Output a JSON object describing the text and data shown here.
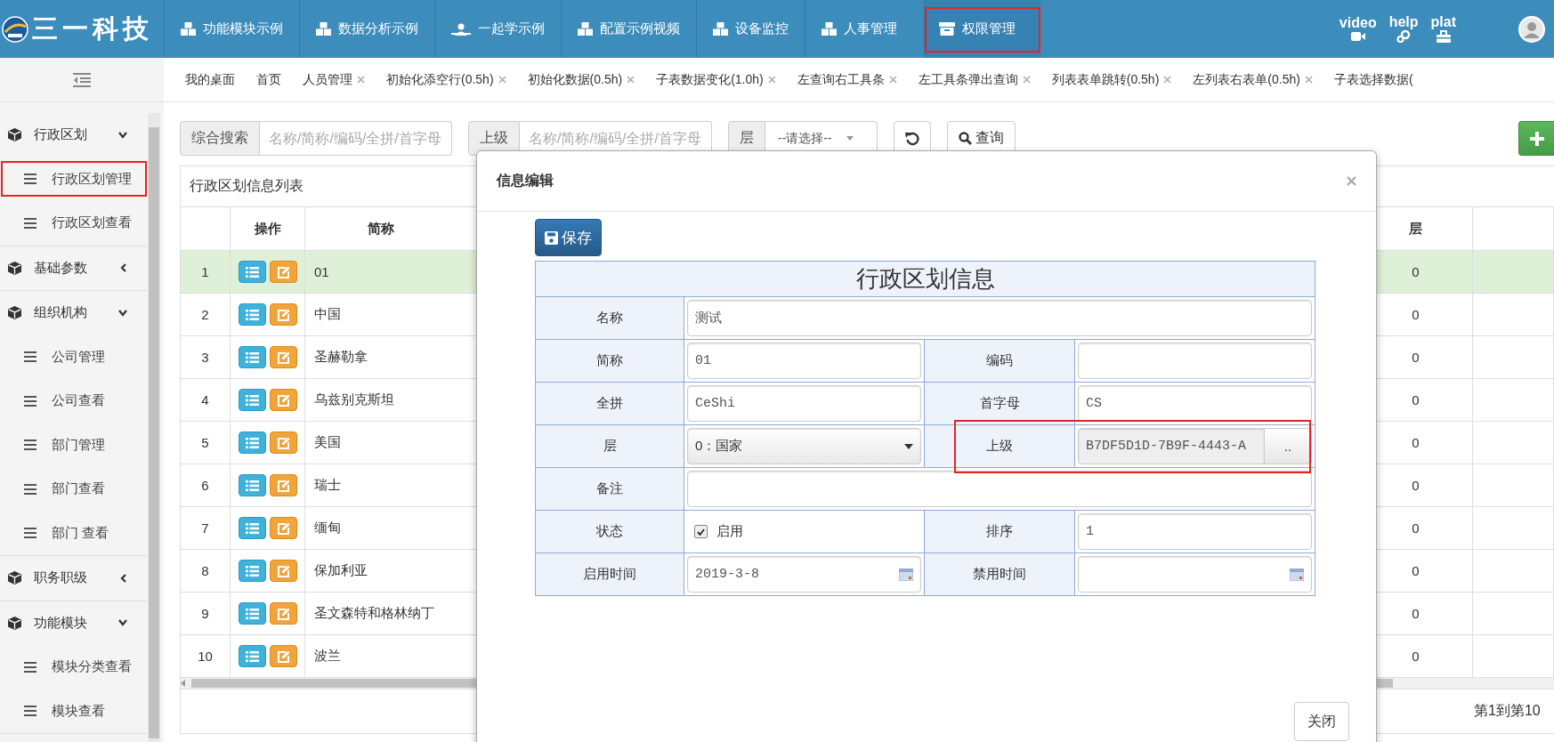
{
  "header": {
    "logo_text": "三一科技",
    "nav": [
      {
        "label": "功能模块示例",
        "kind": "boxes",
        "selected": false,
        "highlighted": false
      },
      {
        "label": "数据分析示例",
        "kind": "boxes",
        "selected": false,
        "highlighted": false
      },
      {
        "label": "一起学示例",
        "kind": "person",
        "selected": false,
        "highlighted": false
      },
      {
        "label": "配置示例视频",
        "kind": "boxes",
        "selected": false,
        "highlighted": false
      },
      {
        "label": "设备监控",
        "kind": "boxes",
        "selected": false,
        "highlighted": false
      },
      {
        "label": "人事管理",
        "kind": "boxes",
        "selected": false,
        "highlighted": false
      },
      {
        "label": "权限管理",
        "kind": "box",
        "selected": true,
        "highlighted": true
      }
    ],
    "shortcuts": [
      {
        "label": "video",
        "kind": "camera"
      },
      {
        "label": "help",
        "kind": "gears"
      },
      {
        "label": "plat",
        "kind": "toolbox"
      }
    ]
  },
  "tabs": [
    {
      "label": "我的桌面",
      "closable": false
    },
    {
      "label": "首页",
      "closable": false
    },
    {
      "label": "人员管理",
      "closable": true
    },
    {
      "label": "初始化添空行(0.5h)",
      "closable": true
    },
    {
      "label": "初始化数据(0.5h)",
      "closable": true
    },
    {
      "label": "子表数据变化(1.0h)",
      "closable": true
    },
    {
      "label": "左查询右工具条",
      "closable": true
    },
    {
      "label": "左工具条弹出查询",
      "closable": true
    },
    {
      "label": "列表表单跳转(0.5h)",
      "closable": true
    },
    {
      "label": "左列表右表单(0.5h)",
      "closable": true
    },
    {
      "label": "子表选择数据(",
      "closable": false
    }
  ],
  "sidebar": {
    "groups": [
      {
        "label": "行政区划",
        "expanded": true,
        "children": [
          {
            "label": "行政区划管理",
            "highlighted": true
          },
          {
            "label": "行政区划查看",
            "highlighted": false
          }
        ]
      },
      {
        "label": "基础参数",
        "expanded": false
      },
      {
        "label": "组织机构",
        "expanded": true,
        "children": [
          {
            "label": "公司管理",
            "highlighted": false
          },
          {
            "label": "公司查看",
            "highlighted": false
          },
          {
            "label": "部门管理",
            "highlighted": false
          },
          {
            "label": "部门查看",
            "highlighted": false
          },
          {
            "label": "部门 查看",
            "highlighted": false
          }
        ]
      },
      {
        "label": "职务职级",
        "expanded": false
      },
      {
        "label": "功能模块",
        "expanded": true,
        "children": [
          {
            "label": "模块分类查看",
            "highlighted": false
          },
          {
            "label": "模块查看",
            "highlighted": false
          }
        ]
      }
    ]
  },
  "search": {
    "fields": [
      {
        "kind": "text",
        "label": "综合搜索",
        "placeholder": "名称/简称/编码/全拼/首字母"
      },
      {
        "kind": "text",
        "label": "上级",
        "placeholder": "名称/简称/编码/全拼/首字母"
      },
      {
        "kind": "select",
        "label": "层",
        "value": "--请选择--"
      }
    ],
    "query_button": "查询"
  },
  "table": {
    "title": "行政区划信息列表",
    "columns": [
      "操作",
      "简称",
      "层"
    ],
    "rows": [
      {
        "number": "1",
        "name": "01",
        "level": "0",
        "selected": true
      },
      {
        "number": "2",
        "name": "中国",
        "level": "0",
        "selected": false
      },
      {
        "number": "3",
        "name": "圣赫勒拿",
        "level": "0",
        "selected": false
      },
      {
        "number": "4",
        "name": "乌兹别克斯坦",
        "level": "0",
        "selected": false
      },
      {
        "number": "5",
        "name": "美国",
        "level": "0",
        "selected": false
      },
      {
        "number": "6",
        "name": "瑞士",
        "level": "0",
        "selected": false
      },
      {
        "number": "7",
        "name": "缅甸",
        "level": "0",
        "selected": false
      },
      {
        "number": "8",
        "name": "保加利亚",
        "level": "0",
        "selected": false
      },
      {
        "number": "9",
        "name": "圣文森特和格林纳丁",
        "level": "0",
        "selected": false
      },
      {
        "number": "10",
        "name": "波兰",
        "level": "0",
        "selected": false
      }
    ],
    "footer": "第1到第10"
  },
  "modal": {
    "title": "信息编辑",
    "save_button": "保存",
    "form_title": "行政区划信息",
    "close_button": "关闭",
    "rows": [
      [
        {
          "label": "名称",
          "kind": "text",
          "value": "测试"
        }
      ],
      [
        {
          "label": "简称",
          "kind": "text",
          "value": "01"
        },
        {
          "label": "编码",
          "kind": "text"
        }
      ],
      [
        {
          "label": "全拼",
          "kind": "text",
          "value": "CeShi"
        },
        {
          "label": "首字母",
          "kind": "text",
          "value": "CS"
        }
      ],
      [
        {
          "label": "层",
          "kind": "select",
          "value": "0：国家"
        },
        {
          "label": "上级",
          "kind": "lookup",
          "value": "B7DF5D1D-7B9F-4443-A",
          "button": "..",
          "highlighted": true
        }
      ],
      [
        {
          "label": "备注",
          "kind": "text"
        }
      ],
      [
        {
          "label": "状态",
          "kind": "checkbox",
          "checked": true,
          "option": "启用"
        },
        {
          "label": "排序",
          "kind": "text",
          "value": "1"
        }
      ],
      [
        {
          "label": "启用时间",
          "kind": "date",
          "value": "2019-3-8"
        },
        {
          "label": "禁用时间",
          "kind": "date"
        }
      ]
    ]
  }
}
